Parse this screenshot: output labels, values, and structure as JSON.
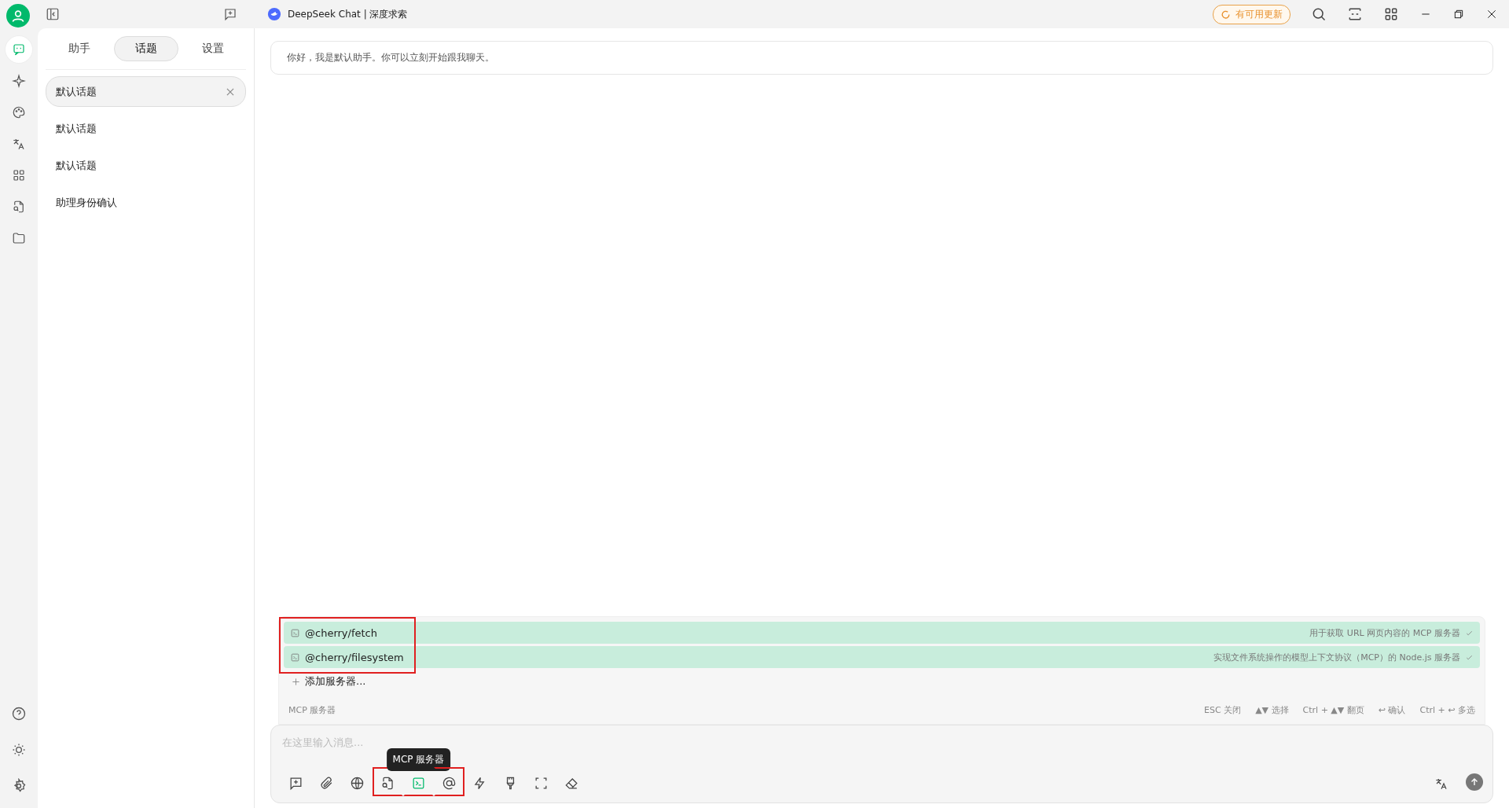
{
  "window": {
    "title": "DeepSeek Chat | 深度求索",
    "update_badge": "有可用更新"
  },
  "tabs": [
    {
      "label": "助手",
      "selected": false
    },
    {
      "label": "话题",
      "selected": true
    },
    {
      "label": "设置",
      "selected": false
    }
  ],
  "rail": {
    "items": [
      {
        "kind": "chat",
        "selected": true
      },
      {
        "kind": "sparkle",
        "selected": false
      },
      {
        "kind": "palette",
        "selected": false
      },
      {
        "kind": "translate",
        "selected": false
      },
      {
        "kind": "apps",
        "selected": false
      },
      {
        "kind": "filesearch",
        "selected": false
      },
      {
        "kind": "folder",
        "selected": false
      }
    ]
  },
  "topics": [
    {
      "label": "默认话题",
      "selected": true
    },
    {
      "label": "默认话题",
      "selected": false
    },
    {
      "label": "默认话题",
      "selected": false
    },
    {
      "label": "助理身份确认",
      "selected": false
    }
  ],
  "greeting": "你好，我是默认助手。你可以立刻开始跟我聊天。",
  "mcp_popup": {
    "servers": [
      {
        "name": "@cherry/fetch",
        "description": "用于获取 URL 网页内容的 MCP 服务器",
        "checked": true,
        "highlighted": true
      },
      {
        "name": "@cherry/filesystem",
        "description": "实现文件系统操作的模型上下文协议（MCP）的 Node.js 服务器",
        "checked": true,
        "highlighted": true
      }
    ],
    "add_label": "添加服务器...",
    "footer_title": "MCP 服务器",
    "shortcuts": [
      "ESC 关闭",
      "▲▼ 选择",
      "Ctrl + ▲▼ 翻页",
      "↩ 确认",
      "Ctrl + ↩ 多选"
    ]
  },
  "input": {
    "placeholder": "在这里输入消息...",
    "tooltip": "MCP 服务器",
    "tools": [
      {
        "kind": "new",
        "selected": false,
        "highlighted": false
      },
      {
        "kind": "attach",
        "selected": false,
        "highlighted": false
      },
      {
        "kind": "globe",
        "selected": false,
        "highlighted": false
      },
      {
        "kind": "filesearch",
        "selected": false,
        "highlighted": true
      },
      {
        "kind": "terminal",
        "selected": true,
        "highlighted": true
      },
      {
        "kind": "at",
        "selected": false,
        "highlighted": true
      },
      {
        "kind": "bolt",
        "selected": false,
        "highlighted": false
      },
      {
        "kind": "brush",
        "selected": false,
        "highlighted": false
      },
      {
        "kind": "expand",
        "selected": false,
        "highlighted": false
      },
      {
        "kind": "eraser",
        "selected": false,
        "highlighted": false
      }
    ]
  }
}
